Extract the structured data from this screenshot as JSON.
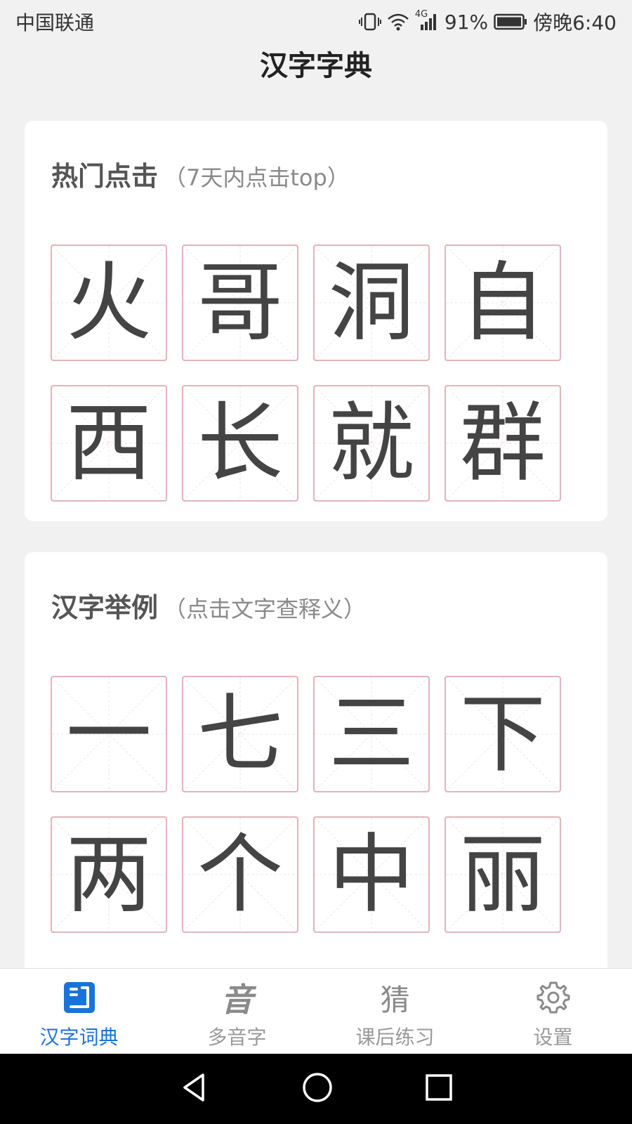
{
  "status_bar": {
    "carrier": "中国联通",
    "network": "4G",
    "battery": "91%",
    "time": "傍晚6:40"
  },
  "page": {
    "title": "汉字字典"
  },
  "hot_section": {
    "title": "热门点击",
    "subtitle": "（7天内点击top）",
    "chars": [
      "火",
      "哥",
      "洞",
      "自",
      "西",
      "长",
      "就",
      "群"
    ]
  },
  "example_section": {
    "title": "汉字举例",
    "subtitle": "（点击文字查释义）",
    "chars": [
      "一",
      "七",
      "三",
      "下",
      "两",
      "个",
      "中",
      "丽"
    ]
  },
  "bottom_nav": {
    "active_color": "#1a73d8",
    "items": [
      {
        "label": "汉字词典",
        "icon": "dictionary-icon",
        "active": true
      },
      {
        "label": "多音字",
        "icon": "polyphone-icon",
        "icon_text": "音",
        "active": false
      },
      {
        "label": "课后练习",
        "icon": "practice-icon",
        "icon_text": "猜",
        "active": false
      },
      {
        "label": "设置",
        "icon": "gear-icon",
        "active": false
      }
    ]
  },
  "colors": {
    "cell_border": "#e2b4b8",
    "background": "#f1f1f1",
    "accent": "#1a73d8"
  }
}
